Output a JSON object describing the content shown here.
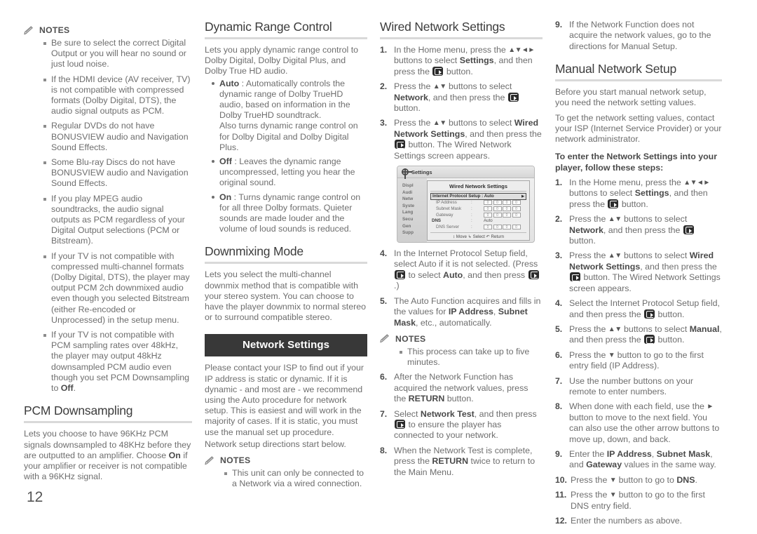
{
  "page": {
    "number": "12"
  },
  "icons": {
    "enter_button": "enter-button-icon",
    "pencil": "pencil-icon",
    "gear": "gear-icon"
  },
  "column1": {
    "notes_label": "NOTES",
    "notes": [
      "Be sure to select the correct Digital Output or you will hear no sound or just loud noise.",
      "If the HDMI device (AV receiver, TV) is not compatible with compressed formats (Dolby Digital, DTS), the audio signal outputs as PCM.",
      "Regular DVDs do not have BONUSVIEW audio and Navigation Sound Effects.",
      "Some Blu-ray Discs do not have BONUSVIEW audio and Navigation Sound Effects.",
      "If you play MPEG audio soundtracks, the audio signal outputs as PCM regardless of your Digital Output selections (PCM or Bitstream).",
      "If your TV is not compatible with compressed multi-channel formats (Dolby Digital, DTS), the player may output PCM 2ch downmixed audio even though you selected Bitstream (either Re-encoded or Unprocessed) in the setup menu."
    ],
    "note_pcm_part1": "If your TV is not compatible with PCM sampling rates over 48kHz, the player may output 48kHz downsampled PCM audio even though you set PCM Downsampling to ",
    "note_pcm_bold": "Off",
    "note_pcm_part2": ".",
    "pcm_heading": "PCM Downsampling",
    "pcm_part1": "Lets you choose to have 96KHz PCM signals downsampled to 48KHz before they are outputted to an amplifier. Choose ",
    "pcm_bold": "On",
    "pcm_part2": " if your amplifier or receiver is not compatible with a 96KHz signal."
  },
  "column2": {
    "drc_heading": "Dynamic Range Control",
    "drc_intro": "Lets you apply dynamic range control to Dolby Digital, Dolby Digital Plus, and Dolby True HD audio.",
    "drc_options": [
      {
        "name": "Auto",
        "sep": " : ",
        "text": "Automatically controls the dynamic range of Dolby TrueHD audio, based on information in the Dolby TrueHD soundtrack.",
        "extra": "Also turns dynamic range control on for Dolby Digital and Dolby Digital Plus."
      },
      {
        "name": "Off",
        "sep": " : ",
        "text": "Leaves the dynamic range uncompressed, letting you hear the original sound.",
        "extra": ""
      },
      {
        "name": "On",
        "sep": " : ",
        "text": "Turns dynamic range control on for all three Dolby formats. Quieter sounds are made louder and the volume of loud sounds is reduced.",
        "extra": ""
      }
    ],
    "downmix_heading": "Downmixing Mode",
    "downmix_text": "Lets you select the multi-channel downmix method that is compatible with your stereo system. You can choose to have the player downmix to normal stereo or to surround compatible stereo.",
    "banner": "Network Settings",
    "network_text": "Please contact your ISP to find out if your IP address is static or dynamic. If it is dynamic - and most are - we recommend using the Auto procedure for network setup. This is easiest and will work in the majority of cases. If it is static, you must use the manual set up procedure.",
    "network_text2": "Network setup directions start below.",
    "notes_label": "NOTES",
    "notes": [
      "This unit can only be connected to a Network via a wired connection."
    ]
  },
  "column3": {
    "heading": "Wired Network Settings",
    "steps": [
      {
        "num": "1.",
        "segments": [
          {
            "t": "In the Home menu, press the "
          },
          {
            "t": "▲▼◄►",
            "style": "arrow"
          },
          {
            "t": " buttons to select "
          },
          {
            "t": "Settings",
            "style": "bold"
          },
          {
            "t": ", and then press the "
          },
          {
            "t": "",
            "style": "enter"
          },
          {
            "t": " button."
          }
        ]
      },
      {
        "num": "2.",
        "segments": [
          {
            "t": "Press the "
          },
          {
            "t": "▲▼",
            "style": "arrow"
          },
          {
            "t": " buttons to select "
          },
          {
            "t": "Network",
            "style": "bold"
          },
          {
            "t": ", and then press the "
          },
          {
            "t": "",
            "style": "enter"
          },
          {
            "t": " button."
          }
        ]
      },
      {
        "num": "3.",
        "segments": [
          {
            "t": "Press the "
          },
          {
            "t": "▲▼",
            "style": "arrow"
          },
          {
            "t": " buttons to select "
          },
          {
            "t": "Wired Network Settings",
            "style": "bold"
          },
          {
            "t": ", and then press the "
          },
          {
            "t": "",
            "style": "enter"
          },
          {
            "t": " button. The Wired Network Settings screen appears."
          }
        ]
      }
    ],
    "screenshot": {
      "window_title": "Settings",
      "sidebar": [
        "Displ",
        "Audi",
        "Netw",
        "Syste",
        "Lang",
        "Secu",
        "Gen",
        "Supp"
      ],
      "panel_title": "Wired Network Settings",
      "selected_row_label": "Internet Protocol Setup",
      "selected_row_value": "Auto",
      "rows": [
        {
          "label": "IP Address",
          "value": "0 0 0 0"
        },
        {
          "label": "Subnet Mask",
          "value": "0 0 0 0"
        },
        {
          "label": "Gateway",
          "value": "0 0 0 0"
        }
      ],
      "dns_label": "DNS",
      "dns_value": "Auto",
      "dns_server_label": "DNS Server",
      "dns_server_value": "0 0 0 0",
      "footer": "Move   Select   Return",
      "footer_move": "Move",
      "footer_select": "Select",
      "footer_return": "Return"
    },
    "steps2": [
      {
        "num": "4.",
        "segments": [
          {
            "t": "In the Internet Protocol Setup field, select Auto if it is not selected. (Press "
          },
          {
            "t": "",
            "style": "enter"
          },
          {
            "t": " to select "
          },
          {
            "t": "Auto",
            "style": "bold"
          },
          {
            "t": ", and then press "
          },
          {
            "t": "",
            "style": "enter"
          },
          {
            "t": ".)"
          }
        ]
      },
      {
        "num": "5.",
        "segments": [
          {
            "t": "The Auto Function acquires and fills in the values for "
          },
          {
            "t": "IP Address",
            "style": "bold"
          },
          {
            "t": ", "
          },
          {
            "t": "Subnet Mask",
            "style": "bold"
          },
          {
            "t": ", etc., automatically."
          }
        ]
      }
    ],
    "notes_label": "NOTES",
    "notes": [
      "This process can take up to five minutes."
    ],
    "steps3": [
      {
        "num": "6.",
        "segments": [
          {
            "t": "After the Network Function has acquired the network values, press the "
          },
          {
            "t": "RETURN",
            "style": "bold"
          },
          {
            "t": " button."
          }
        ]
      },
      {
        "num": "7.",
        "segments": [
          {
            "t": "Select "
          },
          {
            "t": "Network Test",
            "style": "bold"
          },
          {
            "t": ", and then press "
          },
          {
            "t": "",
            "style": "enter"
          },
          {
            "t": " to ensure the player has connected to your network."
          }
        ]
      },
      {
        "num": "8.",
        "segments": [
          {
            "t": "When the Network Test is complete, press the "
          },
          {
            "t": "RETURN",
            "style": "bold"
          },
          {
            "t": " twice to return to the Main Menu."
          }
        ]
      }
    ]
  },
  "column4": {
    "step9": {
      "num": "9.",
      "text": "If the Network Function does not acquire the network values, go to the directions for Manual Setup."
    },
    "heading": "Manual Network Setup",
    "intro1": "Before you start manual network setup, you need the network setting values.",
    "intro2": "To get the network setting values, contact your ISP (Internet Service Provider) or your network administrator.",
    "lead": "To enter the Network Settings into your player, follow these steps:",
    "steps": [
      {
        "num": "1.",
        "segments": [
          {
            "t": "In the Home menu, press the "
          },
          {
            "t": "▲▼◄►",
            "style": "arrow"
          },
          {
            "t": " buttons to select "
          },
          {
            "t": "Settings",
            "style": "bold"
          },
          {
            "t": ", and then press the "
          },
          {
            "t": "",
            "style": "enter"
          },
          {
            "t": " button."
          }
        ]
      },
      {
        "num": "2.",
        "segments": [
          {
            "t": "Press the "
          },
          {
            "t": "▲▼",
            "style": "arrow"
          },
          {
            "t": " buttons to select "
          },
          {
            "t": "Network",
            "style": "bold"
          },
          {
            "t": ", and then press the "
          },
          {
            "t": "",
            "style": "enter"
          },
          {
            "t": " button."
          }
        ]
      },
      {
        "num": "3.",
        "segments": [
          {
            "t": "Press the "
          },
          {
            "t": "▲▼",
            "style": "arrow"
          },
          {
            "t": " buttons to select "
          },
          {
            "t": "Wired Network Settings",
            "style": "bold"
          },
          {
            "t": ", and then press the "
          },
          {
            "t": "",
            "style": "enter"
          },
          {
            "t": " button. The Wired Network Settings screen appears."
          }
        ]
      },
      {
        "num": "4.",
        "segments": [
          {
            "t": "Select the Internet Protocol Setup field, and then press the "
          },
          {
            "t": "",
            "style": "enter"
          },
          {
            "t": " button."
          }
        ]
      },
      {
        "num": "5.",
        "segments": [
          {
            "t": "Press the "
          },
          {
            "t": "▲▼",
            "style": "arrow"
          },
          {
            "t": " buttons to select "
          },
          {
            "t": "Manual",
            "style": "bold"
          },
          {
            "t": ", and then press the "
          },
          {
            "t": "",
            "style": "enter"
          },
          {
            "t": " button."
          }
        ]
      },
      {
        "num": "6.",
        "segments": [
          {
            "t": "Press the "
          },
          {
            "t": "▼",
            "style": "arrow"
          },
          {
            "t": " button to go to the first entry field (IP Address)."
          }
        ]
      },
      {
        "num": "7.",
        "segments": [
          {
            "t": "Use the number buttons on your remote to enter numbers."
          }
        ]
      },
      {
        "num": "8.",
        "segments": [
          {
            "t": "When done with each field, use the "
          },
          {
            "t": "►",
            "style": "arrow"
          },
          {
            "t": " button to move to the next field. You can also use the other arrow buttons to move up, down, and back."
          }
        ]
      },
      {
        "num": "9.",
        "segments": [
          {
            "t": "Enter the "
          },
          {
            "t": "IP Address",
            "style": "bold"
          },
          {
            "t": ", "
          },
          {
            "t": "Subnet Mask",
            "style": "bold"
          },
          {
            "t": ", and "
          },
          {
            "t": "Gateway",
            "style": "bold"
          },
          {
            "t": " values in the same way."
          }
        ]
      },
      {
        "num": "10.",
        "segments": [
          {
            "t": "Press the "
          },
          {
            "t": "▼",
            "style": "arrow"
          },
          {
            "t": " button to go to "
          },
          {
            "t": "DNS",
            "style": "bold"
          },
          {
            "t": "."
          }
        ]
      },
      {
        "num": "11.",
        "segments": [
          {
            "t": "Press the "
          },
          {
            "t": "▼",
            "style": "arrow"
          },
          {
            "t": " button to go to the first DNS entry field."
          }
        ]
      },
      {
        "num": "12.",
        "segments": [
          {
            "t": "Enter the numbers as above."
          }
        ]
      }
    ]
  },
  "colors": {
    "banner_bg": "#383838",
    "body_text": "#6e6e6e",
    "heading_text": "#3c3c3c",
    "rule": "#d9d9d9"
  }
}
